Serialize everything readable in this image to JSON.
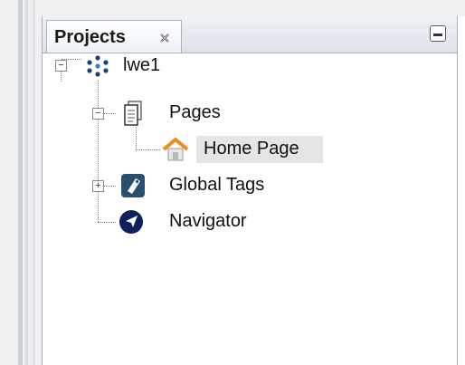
{
  "panel": {
    "tab_title": "Projects",
    "tab_close_icon": "close-icon",
    "minimize_icon": "minimize-icon"
  },
  "tree": {
    "root": {
      "label": "lwe1",
      "icon": "project-network-icon",
      "expanded": true
    },
    "pages": {
      "label": "Pages",
      "icon": "pages-document-icon",
      "expanded": true
    },
    "home_page": {
      "label": "Home Page",
      "icon": "home-icon",
      "selected": true
    },
    "global_tags": {
      "label": "Global Tags",
      "icon": "tag-icon",
      "expanded": false
    },
    "navigator": {
      "label": "Navigator",
      "icon": "navigator-arrow-icon"
    }
  }
}
